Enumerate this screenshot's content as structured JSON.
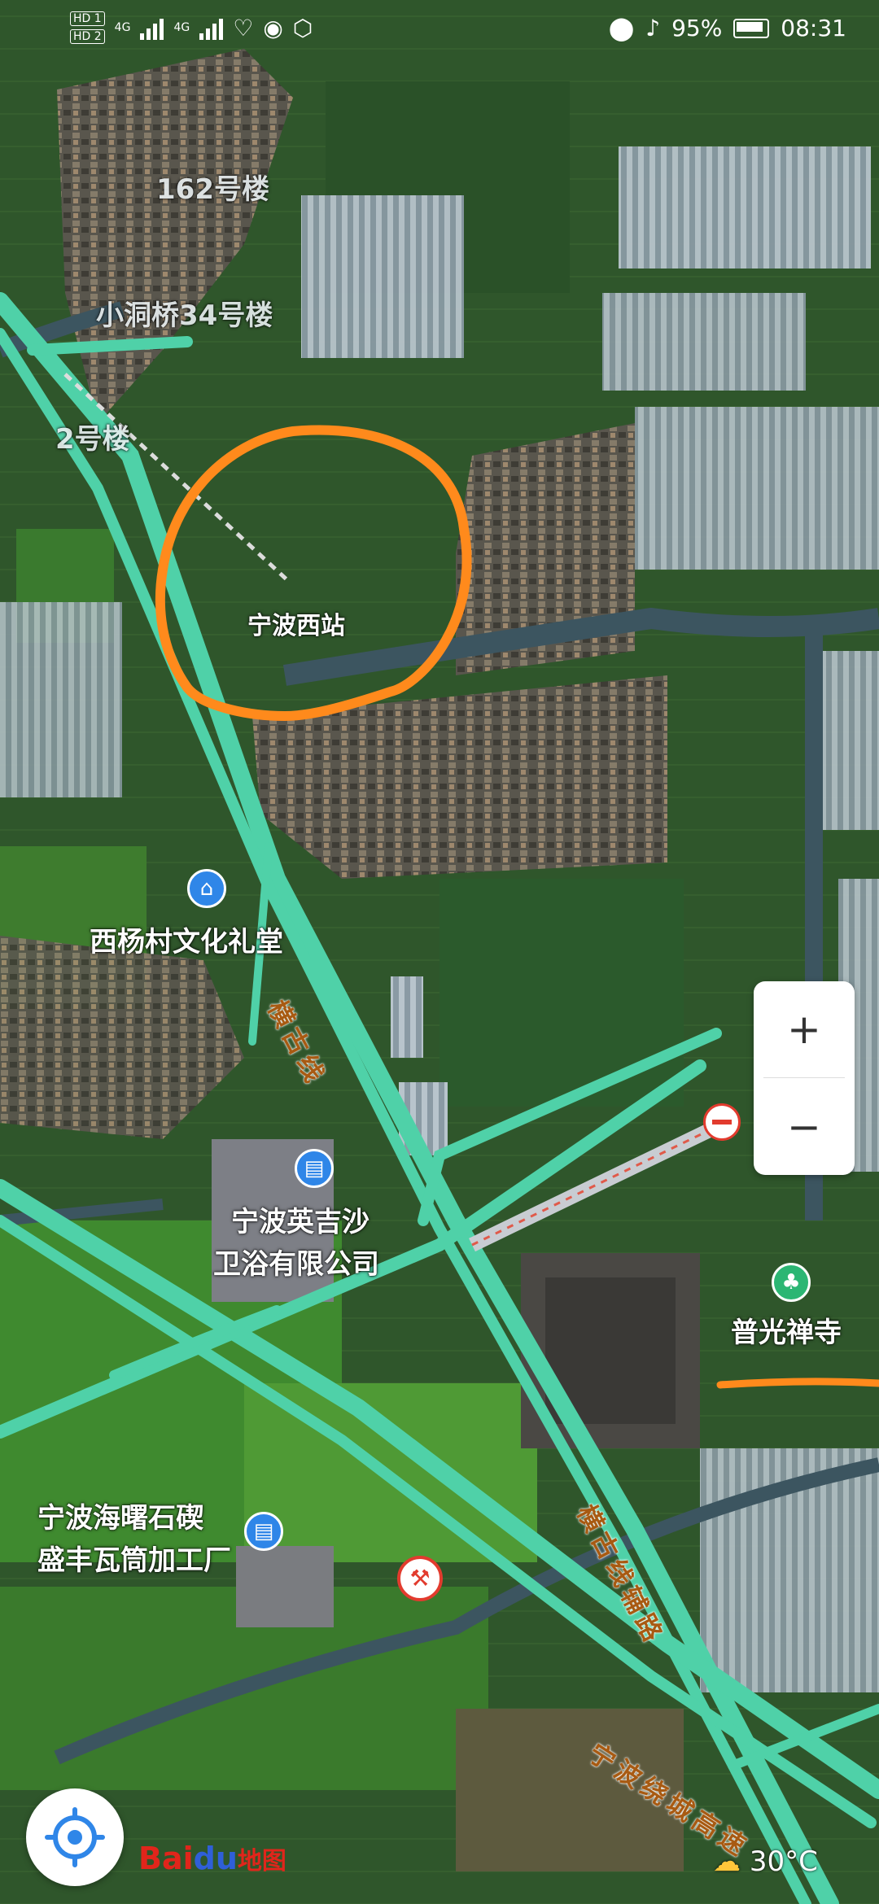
{
  "status_bar": {
    "hd1": "HD 1",
    "hd2": "HD 2",
    "net1": "4G",
    "net2": "4G",
    "battery": "95%",
    "time": "08:31"
  },
  "map": {
    "provider": "Baidu",
    "labels": {
      "bld_162": "162号楼",
      "bld_34": "小洞桥34号楼",
      "bld_2": "2号楼",
      "station": "宁波西站",
      "hall": "西杨村文化礼堂",
      "company_line1": "宁波英吉沙",
      "company_line2": "卫浴有限公司",
      "temple": "普光禅寺",
      "factory_line1": "宁波海曙石碶",
      "factory_line2": "盛丰瓦筒加工厂"
    },
    "roads": {
      "henggu": "横古线",
      "henggu_aux": "横古线辅路",
      "ring": "宁波绕城高速"
    }
  },
  "controls": {
    "zoom_in": "+",
    "zoom_out": "−"
  },
  "logo": {
    "part1": "Bai",
    "part2": "du",
    "part3": "地图"
  },
  "weather": {
    "temp": "30°C"
  },
  "colors": {
    "road": "#4fd1a8",
    "annotation": "#ff8a1c",
    "poi_blue": "#2f86e8",
    "poi_green": "#2bb673"
  }
}
